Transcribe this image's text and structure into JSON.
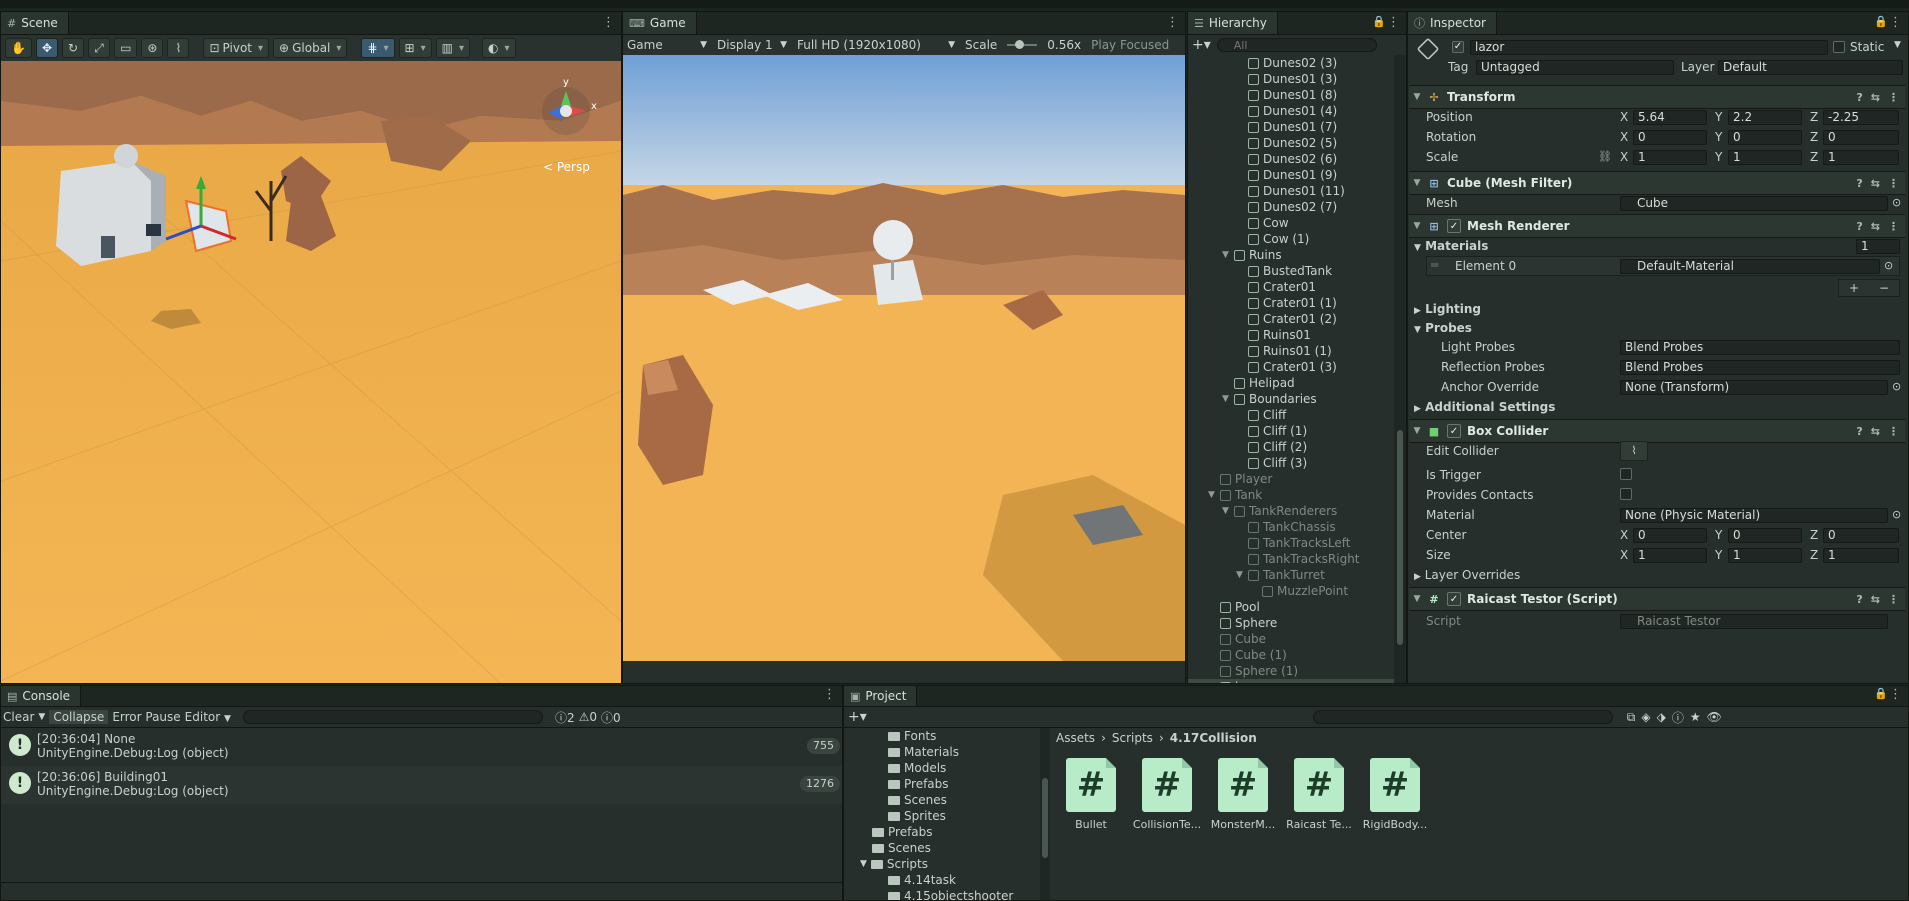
{
  "scene": {
    "tab": "Scene",
    "tools": {
      "pivot": "Pivot",
      "global": "Global"
    },
    "persp": "< Persp"
  },
  "game": {
    "tab": "Game",
    "mode": "Game",
    "display": "Display 1",
    "resolution": "Full HD (1920x1080)",
    "scale_label": "Scale",
    "scale_value": "0.56x",
    "play_focused": "Play Focused"
  },
  "hierarchy": {
    "tab": "Hierarchy",
    "search_placeholder": "All",
    "items": [
      {
        "label": "Dunes02 (3)",
        "indent": 3,
        "dim": false,
        "fold": ""
      },
      {
        "label": "Dunes01 (3)",
        "indent": 3,
        "dim": false,
        "fold": ""
      },
      {
        "label": "Dunes01 (8)",
        "indent": 3,
        "dim": false,
        "fold": ""
      },
      {
        "label": "Dunes01 (4)",
        "indent": 3,
        "dim": false,
        "fold": ""
      },
      {
        "label": "Dunes01 (7)",
        "indent": 3,
        "dim": false,
        "fold": ""
      },
      {
        "label": "Dunes02 (5)",
        "indent": 3,
        "dim": false,
        "fold": ""
      },
      {
        "label": "Dunes02 (6)",
        "indent": 3,
        "dim": false,
        "fold": ""
      },
      {
        "label": "Dunes01 (9)",
        "indent": 3,
        "dim": false,
        "fold": ""
      },
      {
        "label": "Dunes01 (11)",
        "indent": 3,
        "dim": false,
        "fold": ""
      },
      {
        "label": "Dunes02 (7)",
        "indent": 3,
        "dim": false,
        "fold": ""
      },
      {
        "label": "Cow",
        "indent": 3,
        "dim": false,
        "fold": ""
      },
      {
        "label": "Cow (1)",
        "indent": 3,
        "dim": false,
        "fold": ""
      },
      {
        "label": "Ruins",
        "indent": 2,
        "dim": false,
        "fold": "▼"
      },
      {
        "label": "BustedTank",
        "indent": 3,
        "dim": false,
        "fold": ""
      },
      {
        "label": "Crater01",
        "indent": 3,
        "dim": false,
        "fold": ""
      },
      {
        "label": "Crater01 (1)",
        "indent": 3,
        "dim": false,
        "fold": ""
      },
      {
        "label": "Crater01 (2)",
        "indent": 3,
        "dim": false,
        "fold": ""
      },
      {
        "label": "Ruins01",
        "indent": 3,
        "dim": false,
        "fold": ""
      },
      {
        "label": "Ruins01 (1)",
        "indent": 3,
        "dim": false,
        "fold": ""
      },
      {
        "label": "Crater01 (3)",
        "indent": 3,
        "dim": false,
        "fold": ""
      },
      {
        "label": "Helipad",
        "indent": 2,
        "dim": false,
        "fold": ""
      },
      {
        "label": "Boundaries",
        "indent": 2,
        "dim": false,
        "fold": "▼"
      },
      {
        "label": "Cliff",
        "indent": 3,
        "dim": false,
        "fold": ""
      },
      {
        "label": "Cliff (1)",
        "indent": 3,
        "dim": false,
        "fold": ""
      },
      {
        "label": "Cliff (2)",
        "indent": 3,
        "dim": false,
        "fold": ""
      },
      {
        "label": "Cliff (3)",
        "indent": 3,
        "dim": false,
        "fold": ""
      },
      {
        "label": "Player",
        "indent": 1,
        "dim": true,
        "fold": ""
      },
      {
        "label": "Tank",
        "indent": 1,
        "dim": true,
        "fold": "▼"
      },
      {
        "label": "TankRenderers",
        "indent": 2,
        "dim": true,
        "fold": "▼"
      },
      {
        "label": "TankChassis",
        "indent": 3,
        "dim": true,
        "fold": ""
      },
      {
        "label": "TankTracksLeft",
        "indent": 3,
        "dim": true,
        "fold": ""
      },
      {
        "label": "TankTracksRight",
        "indent": 3,
        "dim": true,
        "fold": ""
      },
      {
        "label": "TankTurret",
        "indent": 3,
        "dim": true,
        "fold": "▼"
      },
      {
        "label": "MuzzlePoint",
        "indent": 4,
        "dim": true,
        "fold": ""
      },
      {
        "label": "Pool",
        "indent": 1,
        "dim": false,
        "fold": ""
      },
      {
        "label": "Sphere",
        "indent": 1,
        "dim": false,
        "fold": ""
      },
      {
        "label": "Cube",
        "indent": 1,
        "dim": true,
        "fold": ""
      },
      {
        "label": "Cube (1)",
        "indent": 1,
        "dim": true,
        "fold": ""
      },
      {
        "label": "Sphere (1)",
        "indent": 1,
        "dim": true,
        "fold": ""
      },
      {
        "label": "lazor",
        "indent": 1,
        "dim": false,
        "fold": "",
        "selected": true
      }
    ]
  },
  "inspector": {
    "tab": "Inspector",
    "object_name": "lazor",
    "static_label": "Static",
    "tag_label": "Tag",
    "tag_value": "Untagged",
    "layer_label": "Layer",
    "layer_value": "Default",
    "transform": {
      "title": "Transform",
      "position_label": "Position",
      "rotation_label": "Rotation",
      "scale_label": "Scale",
      "position": {
        "x": "5.64",
        "y": "2.2",
        "z": "-2.25"
      },
      "rotation": {
        "x": "0",
        "y": "0",
        "z": "0"
      },
      "scale": {
        "x": "1",
        "y": "1",
        "z": "1"
      }
    },
    "mesh_filter": {
      "title": "Cube (Mesh Filter)",
      "mesh_label": "Mesh",
      "mesh_value": "Cube"
    },
    "mesh_renderer": {
      "title": "Mesh Renderer",
      "materials_label": "Materials",
      "materials_count": "1",
      "element_label": "Element 0",
      "element_value": "Default-Material",
      "lighting": "Lighting",
      "probes": "Probes",
      "light_probes_label": "Light Probes",
      "light_probes_value": "Blend Probes",
      "reflection_probes_label": "Reflection Probes",
      "reflection_probes_value": "Blend Probes",
      "anchor_override_label": "Anchor Override",
      "anchor_override_value": "None (Transform)",
      "additional_settings": "Additional Settings"
    },
    "box_collider": {
      "title": "Box Collider",
      "edit_collider": "Edit Collider",
      "is_trigger": "Is Trigger",
      "provides_contacts": "Provides Contacts",
      "material_label": "Material",
      "material_value": "None (Physic Material)",
      "center_label": "Center",
      "center": {
        "x": "0",
        "y": "0",
        "z": "0"
      },
      "size_label": "Size",
      "size": {
        "x": "1",
        "y": "1",
        "z": "1"
      },
      "layer_overrides": "Layer Overrides"
    },
    "script": {
      "title": "Raicast Testor (Script)",
      "script_label": "Script",
      "script_value": "Raicast Testor"
    }
  },
  "console": {
    "tab": "Console",
    "clear": "Clear",
    "collapse": "Collapse",
    "error_pause": "Error Pause",
    "editor": "Editor",
    "counts": {
      "log": "2",
      "warn": "0",
      "error": "0"
    },
    "entries": [
      {
        "line1": "[20:36:04] None",
        "line2": "UnityEngine.Debug:Log (object)",
        "count": "755"
      },
      {
        "line1": "[20:36:06] Building01",
        "line2": "UnityEngine.Debug:Log (object)",
        "count": "1276"
      }
    ]
  },
  "project": {
    "tab": "Project",
    "breadcrumb": [
      "Assets",
      "Scripts",
      "4.17Collision"
    ],
    "tree": [
      {
        "label": "Fonts",
        "indent": 2
      },
      {
        "label": "Materials",
        "indent": 2
      },
      {
        "label": "Models",
        "indent": 2
      },
      {
        "label": "Prefabs",
        "indent": 2
      },
      {
        "label": "Scenes",
        "indent": 2
      },
      {
        "label": "Sprites",
        "indent": 2
      },
      {
        "label": "Prefabs",
        "indent": 1
      },
      {
        "label": "Scenes",
        "indent": 1
      },
      {
        "label": "Scripts",
        "indent": 1,
        "open": true
      },
      {
        "label": "4.14task",
        "indent": 2
      },
      {
        "label": "4.15objectshooter",
        "indent": 2
      }
    ],
    "assets": [
      "Bullet",
      "CollisionTe...",
      "MonsterM...",
      "Raicast Te...",
      "RigidBody..."
    ]
  }
}
